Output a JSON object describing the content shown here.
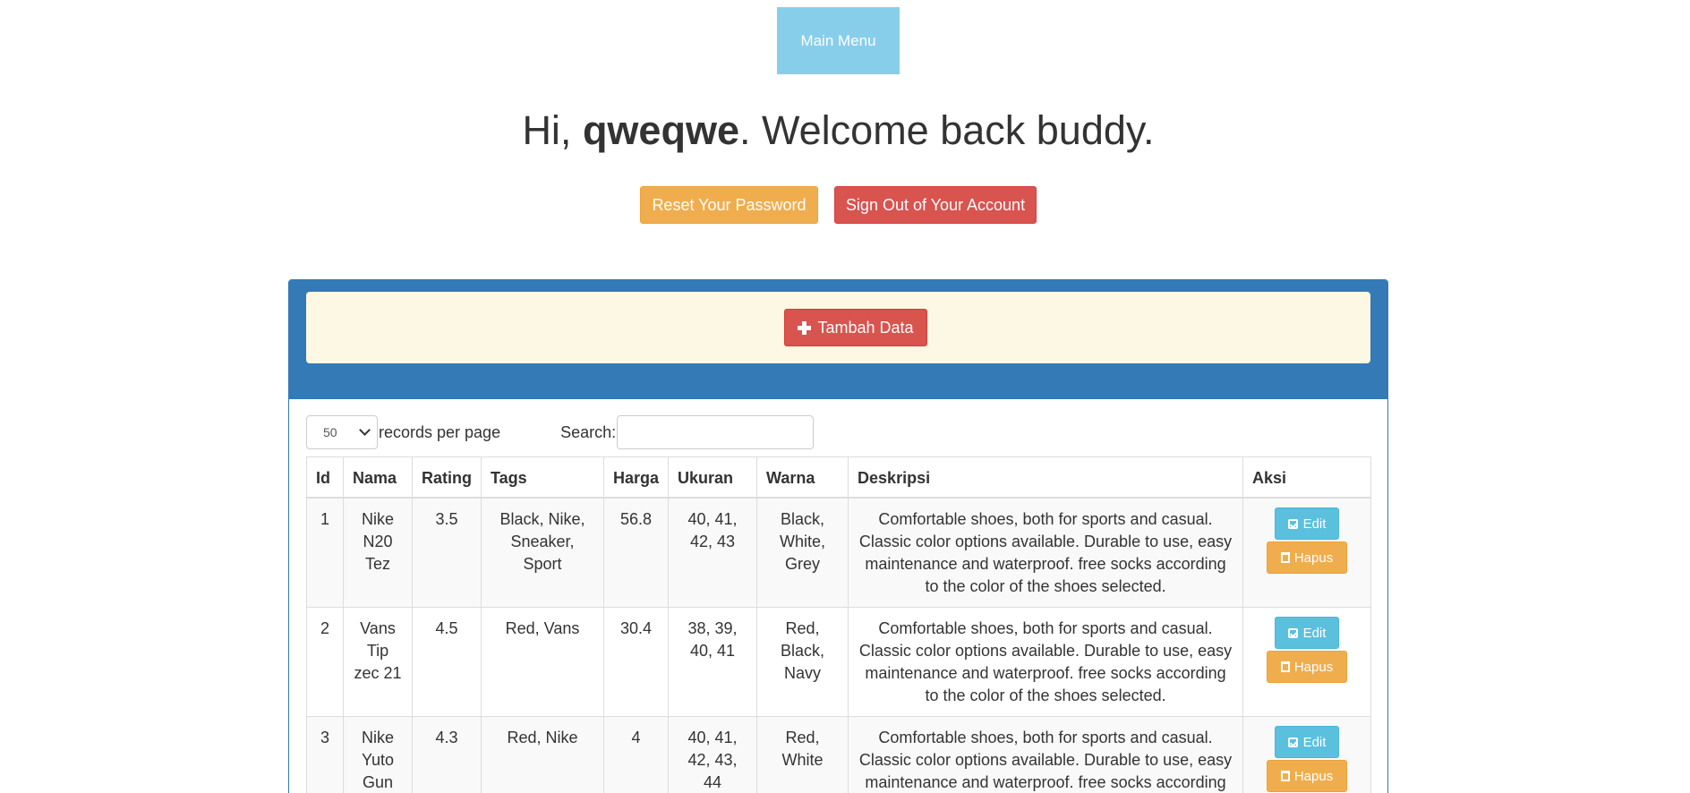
{
  "nav": {
    "main_menu_label": "Main Menu"
  },
  "welcome": {
    "prefix": "Hi, ",
    "username": "qweqwe",
    "suffix": ". Welcome back buddy."
  },
  "account_actions": {
    "reset_password_label": "Reset Your Password",
    "sign_out_label": "Sign Out of Your Account"
  },
  "panel": {
    "add_data_label": "Tambah Data"
  },
  "table_controls": {
    "per_page_value": "50",
    "per_page_label": "records per page",
    "search_label": "Search:",
    "search_value": ""
  },
  "table": {
    "headers": [
      "Id",
      "Nama",
      "Rating",
      "Tags",
      "Harga",
      "Ukuran",
      "Warna",
      "Deskripsi",
      "Aksi"
    ],
    "edit_label": "Edit",
    "delete_label": "Hapus",
    "rows": [
      {
        "id": "1",
        "nama": "Nike N20 Tez",
        "rating": "3.5",
        "tags": "Black, Nike, Sneaker, Sport",
        "harga": "56.8",
        "ukuran": "40, 41, 42, 43",
        "warna": "Black, White, Grey",
        "deskripsi": "Comfortable shoes, both for sports and casual. Classic color options available. Durable to use, easy maintenance and waterproof. free socks according to the color of the shoes selected."
      },
      {
        "id": "2",
        "nama": "Vans Tip zec 21",
        "rating": "4.5",
        "tags": "Red, Vans",
        "harga": "30.4",
        "ukuran": "38, 39, 40, 41",
        "warna": "Red, Black, Navy",
        "deskripsi": "Comfortable shoes, both for sports and casual. Classic color options available. Durable to use, easy maintenance and waterproof. free socks according to the color of the shoes selected."
      },
      {
        "id": "3",
        "nama": "Nike Yuto Gun",
        "rating": "4.3",
        "tags": "Red, Nike",
        "harga": "4",
        "ukuran": "40, 41, 42, 43, 44",
        "warna": "Red, White",
        "deskripsi": "Comfortable shoes, both for sports and casual. Classic color options available. Durable to use, easy maintenance and waterproof. free socks according to the color of the shoes selected."
      }
    ]
  }
}
